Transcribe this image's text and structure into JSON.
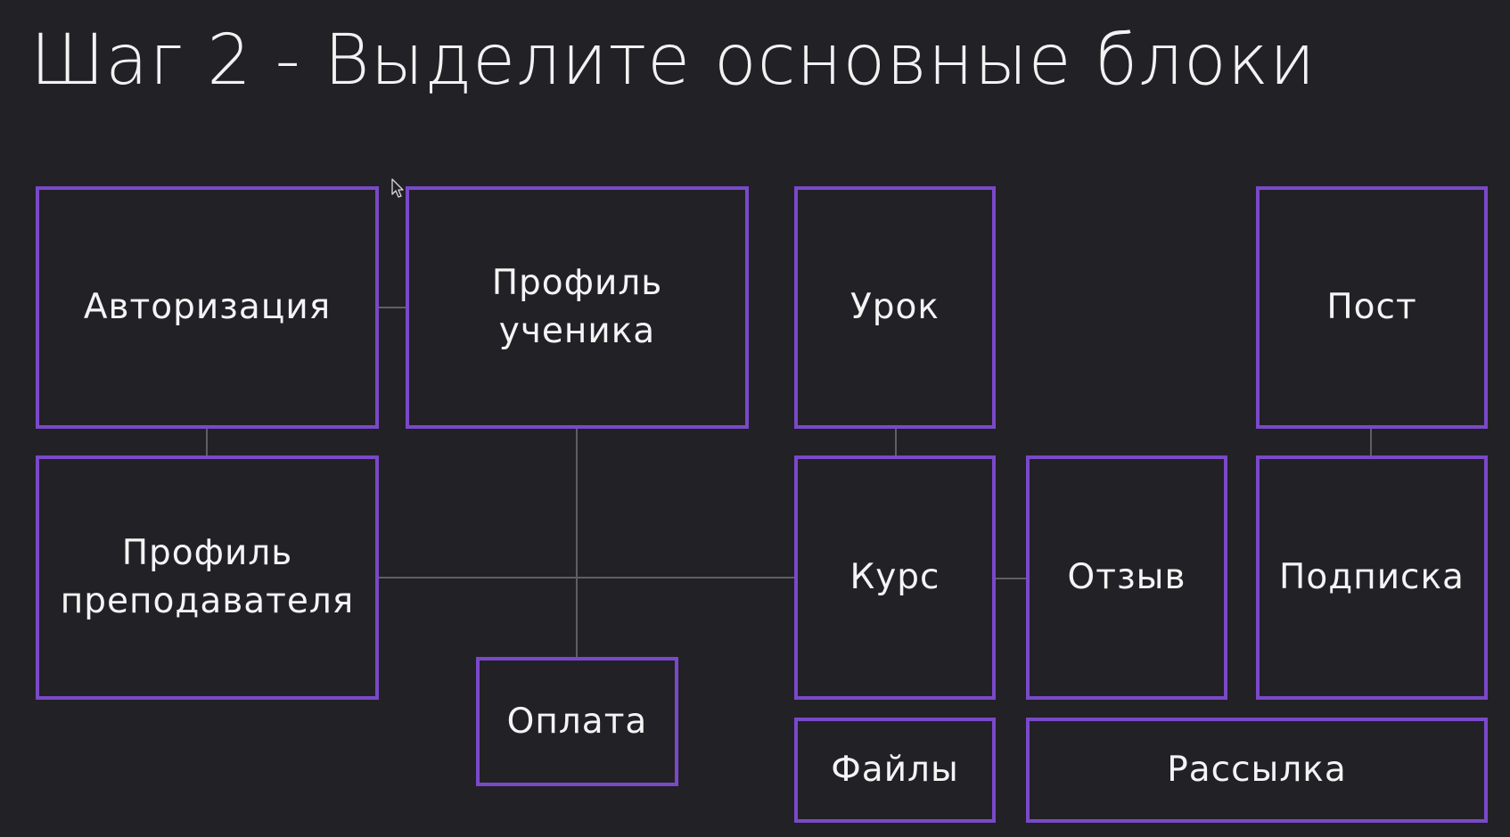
{
  "slide": {
    "title": "Шаг 2 - Выделите основные блоки"
  },
  "colors": {
    "background": "#222126",
    "box_border": "#7a49c9",
    "connector": "#5f5f63",
    "text": "#f4f4f4"
  },
  "blocks": {
    "authorization": "Авторизация",
    "student_profile": "Профиль\nученика",
    "lesson": "Урок",
    "post": "Пост",
    "teacher_profile": "Профиль\nпреподавателя",
    "course": "Курс",
    "review": "Отзыв",
    "subscription": "Подписка",
    "payment": "Оплата",
    "files": "Файлы",
    "mailing": "Рассылка"
  },
  "icons": {
    "cursor": "mouse-pointer-icon"
  }
}
